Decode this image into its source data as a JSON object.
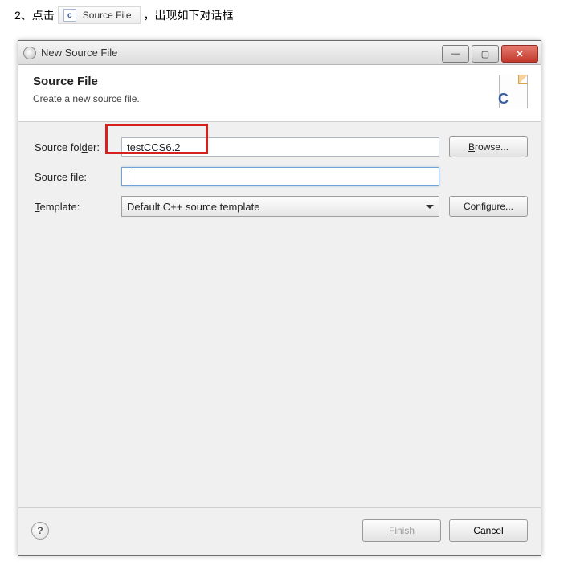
{
  "intro": {
    "num": "2、",
    "prefix": "点击",
    "menu_label": "Source File",
    "suffix": "，出现如下对话框"
  },
  "dialog": {
    "title": "New Source File",
    "header_title": "Source File",
    "header_desc": "Create a new source file.",
    "header_icon_letter": "C",
    "labels": {
      "source_folder_pre": "Source fol",
      "source_folder_ul": "d",
      "source_folder_post": "er:",
      "source_file": "Source file:",
      "template_ul": "T",
      "template_post": "emplate:"
    },
    "values": {
      "source_folder": "testCCS6.2",
      "source_file": "",
      "template_selected": "Default C++ source template"
    },
    "buttons": {
      "browse_ul": "B",
      "browse_post": "rowse...",
      "configure": "Configure...",
      "finish_ul": "F",
      "finish_post": "inish",
      "cancel": "Cancel"
    },
    "help_glyph": "?"
  }
}
